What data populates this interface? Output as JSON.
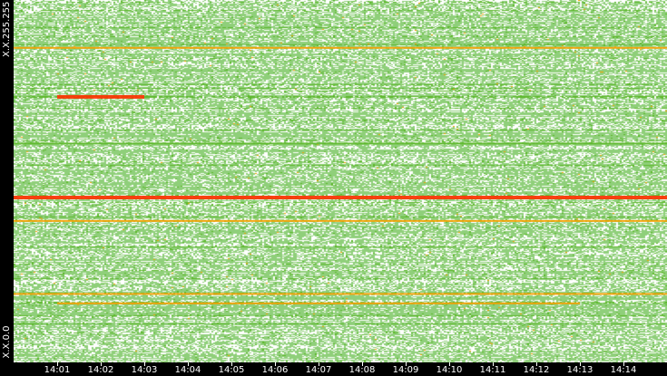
{
  "chart_data": {
    "type": "heatmap",
    "title": "",
    "xlabel": "",
    "ylabel": "",
    "x_ticks": [
      "14:01",
      "14:02",
      "14:03",
      "14:04",
      "14:05",
      "14:06",
      "14:07",
      "14:08",
      "14:09",
      "14:10",
      "14:11",
      "14:12",
      "14:13",
      "14:14"
    ],
    "x_range_minutes": [
      14.0,
      14.25
    ],
    "y_labels": {
      "top": "X.X.255.255",
      "bottom": "X.X.0.0"
    },
    "y_range_index": [
      0,
      65535
    ],
    "colors": {
      "empty": "#ffffff",
      "low": "#8fcf7a",
      "mid": "#5db82a",
      "high": "#f5a000",
      "peak": "#ff3000"
    },
    "hot_rows": [
      {
        "y_index": 29900,
        "x_start": "14:00",
        "x_end": "14:15",
        "level": "peak"
      },
      {
        "y_index": 25500,
        "x_start": "14:00",
        "x_end": "14:15",
        "level": "high"
      },
      {
        "y_index": 39500,
        "x_start": "14:00",
        "x_end": "14:15",
        "level": "mid"
      },
      {
        "y_index": 56800,
        "x_start": "14:00",
        "x_end": "14:15",
        "level": "high"
      },
      {
        "y_index": 12300,
        "x_start": "14:00",
        "x_end": "14:15",
        "level": "high"
      },
      {
        "y_index": 10600,
        "x_start": "14:01",
        "x_end": "14:13",
        "level": "high"
      },
      {
        "y_index": 48100,
        "x_start": "14:01",
        "x_end": "14:03",
        "level": "peak"
      }
    ]
  }
}
